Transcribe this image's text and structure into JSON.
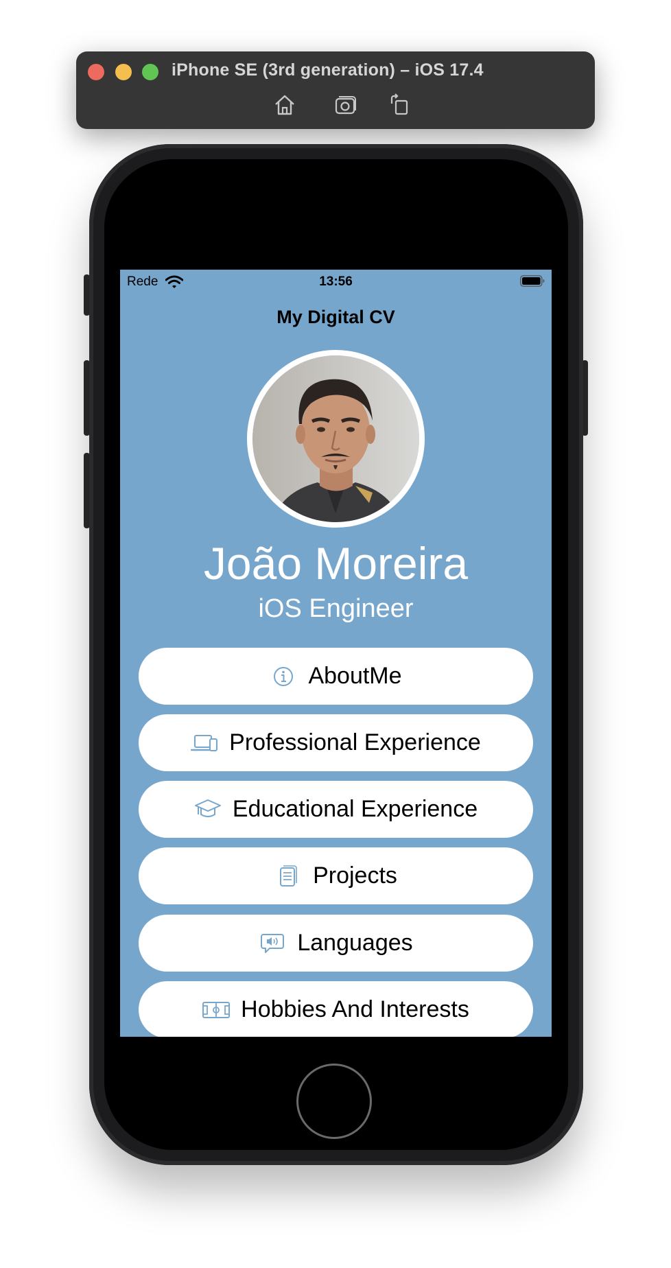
{
  "simulator": {
    "title": "iPhone SE (3rd generation) – iOS 17.4",
    "toolbar_icons": [
      "home-icon",
      "screenshot-icon",
      "rotate-icon"
    ]
  },
  "status_bar": {
    "carrier": "Rede",
    "time": "13:56"
  },
  "nav": {
    "title": "My Digital CV"
  },
  "profile": {
    "name": "João Moreira",
    "role": "iOS Engineer"
  },
  "colors": {
    "background": "#77a6cd",
    "icon_tint": "#77a6cd",
    "button_bg": "#ffffff"
  },
  "menu": {
    "items": [
      {
        "label": "AboutMe",
        "icon": "info-circle-icon"
      },
      {
        "label": "Professional Experience",
        "icon": "laptop-phone-icon"
      },
      {
        "label": "Educational Experience",
        "icon": "graduation-cap-icon"
      },
      {
        "label": "Projects",
        "icon": "document-icon"
      },
      {
        "label": "Languages",
        "icon": "speech-bubble-speaker-icon"
      },
      {
        "label": "Hobbies And Interests",
        "icon": "soccer-field-icon"
      }
    ]
  }
}
